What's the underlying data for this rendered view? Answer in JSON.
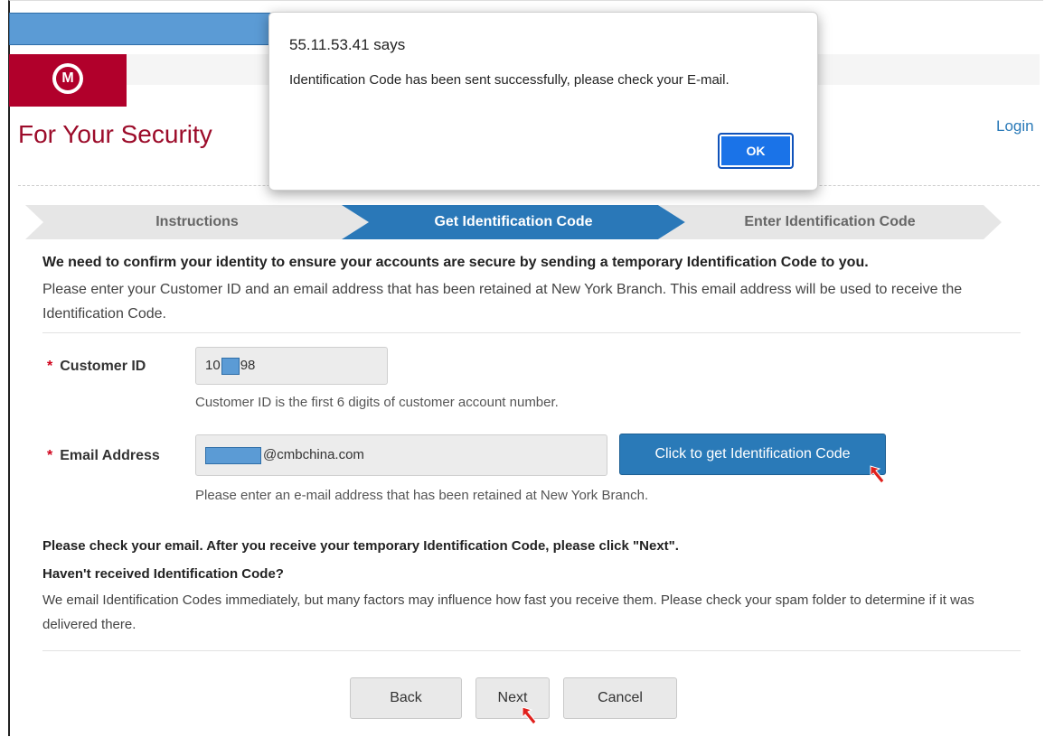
{
  "header": {
    "title": "For Your Security",
    "login_label": "Login",
    "logo_letter": "M"
  },
  "steps": [
    {
      "label": "Instructions",
      "state": "done"
    },
    {
      "label": "Get Identification Code",
      "state": "active"
    },
    {
      "label": "Enter Identification Code",
      "state": "pending"
    }
  ],
  "intro": {
    "bold": "We need to confirm your identity to ensure your accounts are secure by sending a temporary Identification Code to you.",
    "text": "Please enter your Customer ID and an email address that has been retained at New York Branch. This email address will be used to receive the Identification Code."
  },
  "form": {
    "required_mark": "*",
    "customer_id": {
      "label": "Customer ID",
      "value_prefix": "10",
      "value_suffix": "98",
      "hint": "Customer ID is the first 6 digits of customer account number."
    },
    "email": {
      "label": "Email Address",
      "value_suffix": "@cmbchina.com",
      "hint": "Please enter an e-mail address that has been retained at New York Branch."
    },
    "get_code_label": "Click to get Identification Code"
  },
  "check_email": "Please check your email. After you receive your temporary Identification Code, please click \"Next\".",
  "havent": {
    "title": "Haven't received Identification Code?",
    "text": "We email Identification Codes immediately, but many factors may influence how fast you receive them. Please check your spam folder to determine if it was delivered there."
  },
  "buttons": {
    "back": "Back",
    "next": "Next",
    "cancel": "Cancel"
  },
  "dialog": {
    "title": "55.11.53.41 says",
    "message": "Identification Code has been sent successfully, please check your E-mail.",
    "ok": "OK"
  },
  "colors": {
    "brand_red": "#b1002b",
    "accent_blue": "#2a78b8",
    "dialog_ok": "#1a73e8",
    "cursor_arrow": "#e0201c"
  }
}
